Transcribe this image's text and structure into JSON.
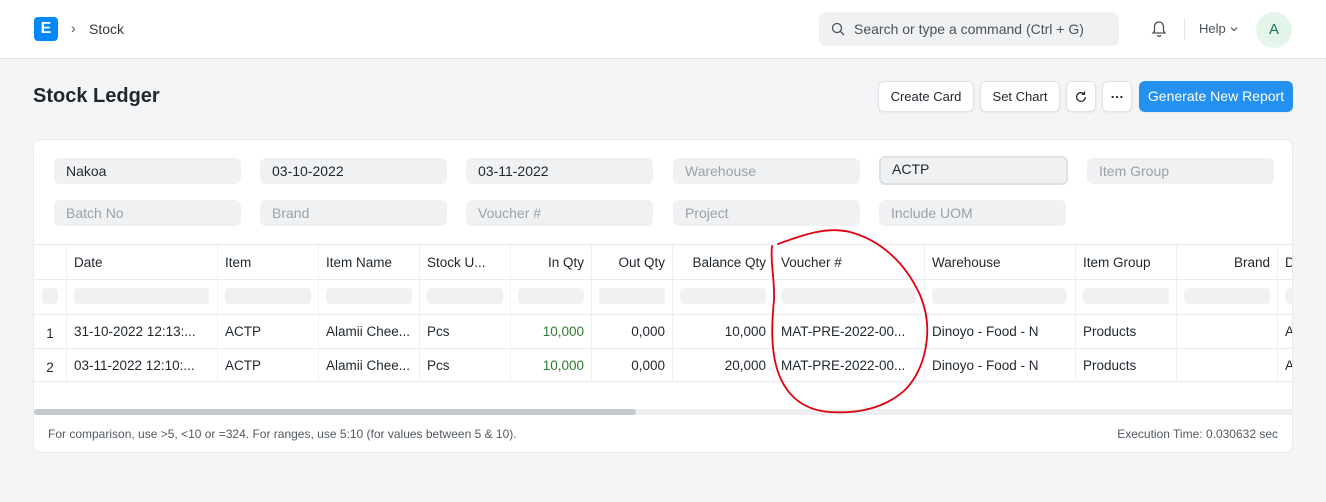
{
  "navbar": {
    "logo_letter": "E",
    "breadcrumb": "Stock",
    "search_placeholder": "Search or type a command (Ctrl + G)",
    "help_label": "Help",
    "avatar_letter": "A"
  },
  "page": {
    "title": "Stock Ledger",
    "buttons": {
      "create_card": "Create Card",
      "set_chart": "Set Chart",
      "refresh_icon": "refresh-icon",
      "more_icon": "more-icon",
      "generate": "Generate New Report"
    }
  },
  "filters": {
    "company": "Nakoa",
    "from_date": "03-10-2022",
    "to_date": "03-11-2022",
    "warehouse": "Warehouse",
    "item": "ACTP",
    "item_group": "Item Group",
    "batch_no": "Batch No",
    "brand": "Brand",
    "voucher_no": "Voucher #",
    "project": "Project",
    "include_uom": "Include UOM"
  },
  "table": {
    "columns": [
      "Date",
      "Item",
      "Item Name",
      "Stock U...",
      "In Qty",
      "Out Qty",
      "Balance Qty",
      "Voucher #",
      "Warehouse",
      "Item Group",
      "Brand",
      "D"
    ],
    "rows": [
      {
        "index": "1",
        "date": "31-10-2022 12:13:...",
        "item": "ACTP",
        "item_name": "Alamii Chee...",
        "uom": "Pcs",
        "in_qty": "10,000",
        "out_qty": "0,000",
        "balance_qty": "10,000",
        "voucher": "MAT-PRE-2022-00...",
        "warehouse": "Dinoyo - Food - N",
        "item_group": "Products",
        "brand": "",
        "extra": "A"
      },
      {
        "index": "2",
        "date": "03-11-2022 12:10:...",
        "item": "ACTP",
        "item_name": "Alamii Chee...",
        "uom": "Pcs",
        "in_qty": "10,000",
        "out_qty": "0,000",
        "balance_qty": "20,000",
        "voucher": "MAT-PRE-2022-00...",
        "warehouse": "Dinoyo - Food - N",
        "item_group": "Products",
        "brand": "",
        "extra": "A"
      }
    ]
  },
  "footer": {
    "note": "For comparison, use >5, <10 or =324. For ranges, use 5:10 (for values between 5 & 10).",
    "execution": "Execution Time: 0.030632 sec"
  },
  "colors": {
    "primary": "#2490ef",
    "in_qty_green": "#2e7d32",
    "annotation_red": "#e0000f"
  }
}
